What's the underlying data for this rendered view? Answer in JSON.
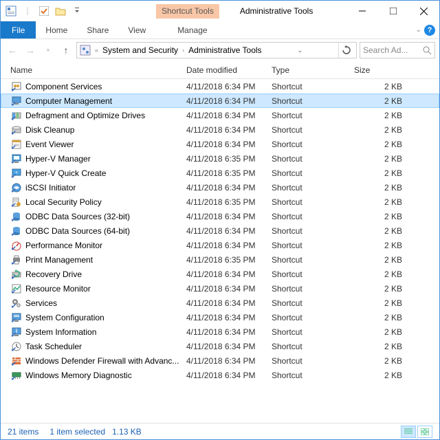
{
  "title": "Administrative Tools",
  "contextual_tab": "Shortcut Tools",
  "ribbon": {
    "file": "File",
    "home": "Home",
    "share": "Share",
    "view": "View",
    "manage": "Manage"
  },
  "breadcrumb": {
    "p1": "System and Security",
    "p2": "Administrative Tools"
  },
  "search": {
    "placeholder": "Search Ad..."
  },
  "columns": {
    "name": "Name",
    "date": "Date modified",
    "type": "Type",
    "size": "Size"
  },
  "status": {
    "count": "21 items",
    "selection": "1 item selected",
    "size": "1.13 KB"
  },
  "items": [
    {
      "name": "Component Services",
      "date": "4/11/2018 6:34 PM",
      "type": "Shortcut",
      "size": "2 KB",
      "icon": "component"
    },
    {
      "name": "Computer Management",
      "date": "4/11/2018 6:34 PM",
      "type": "Shortcut",
      "size": "2 KB",
      "icon": "computer",
      "selected": true
    },
    {
      "name": "Defragment and Optimize Drives",
      "date": "4/11/2018 6:34 PM",
      "type": "Shortcut",
      "size": "2 KB",
      "icon": "defrag"
    },
    {
      "name": "Disk Cleanup",
      "date": "4/11/2018 6:34 PM",
      "type": "Shortcut",
      "size": "2 KB",
      "icon": "disk"
    },
    {
      "name": "Event Viewer",
      "date": "4/11/2018 6:34 PM",
      "type": "Shortcut",
      "size": "2 KB",
      "icon": "event"
    },
    {
      "name": "Hyper-V Manager",
      "date": "4/11/2018 6:35 PM",
      "type": "Shortcut",
      "size": "2 KB",
      "icon": "hyperv"
    },
    {
      "name": "Hyper-V Quick Create",
      "date": "4/11/2018 6:35 PM",
      "type": "Shortcut",
      "size": "2 KB",
      "icon": "hypervq"
    },
    {
      "name": "iSCSI Initiator",
      "date": "4/11/2018 6:34 PM",
      "type": "Shortcut",
      "size": "2 KB",
      "icon": "iscsi"
    },
    {
      "name": "Local Security Policy",
      "date": "4/11/2018 6:35 PM",
      "type": "Shortcut",
      "size": "2 KB",
      "icon": "policy"
    },
    {
      "name": "ODBC Data Sources (32-bit)",
      "date": "4/11/2018 6:34 PM",
      "type": "Shortcut",
      "size": "2 KB",
      "icon": "odbc"
    },
    {
      "name": "ODBC Data Sources (64-bit)",
      "date": "4/11/2018 6:34 PM",
      "type": "Shortcut",
      "size": "2 KB",
      "icon": "odbc"
    },
    {
      "name": "Performance Monitor",
      "date": "4/11/2018 6:34 PM",
      "type": "Shortcut",
      "size": "2 KB",
      "icon": "perf"
    },
    {
      "name": "Print Management",
      "date": "4/11/2018 6:35 PM",
      "type": "Shortcut",
      "size": "2 KB",
      "icon": "print"
    },
    {
      "name": "Recovery Drive",
      "date": "4/11/2018 6:34 PM",
      "type": "Shortcut",
      "size": "2 KB",
      "icon": "recovery"
    },
    {
      "name": "Resource Monitor",
      "date": "4/11/2018 6:34 PM",
      "type": "Shortcut",
      "size": "2 KB",
      "icon": "resource"
    },
    {
      "name": "Services",
      "date": "4/11/2018 6:34 PM",
      "type": "Shortcut",
      "size": "2 KB",
      "icon": "services"
    },
    {
      "name": "System Configuration",
      "date": "4/11/2018 6:34 PM",
      "type": "Shortcut",
      "size": "2 KB",
      "icon": "sysconfig"
    },
    {
      "name": "System Information",
      "date": "4/11/2018 6:34 PM",
      "type": "Shortcut",
      "size": "2 KB",
      "icon": "sysinfo"
    },
    {
      "name": "Task Scheduler",
      "date": "4/11/2018 6:34 PM",
      "type": "Shortcut",
      "size": "2 KB",
      "icon": "task"
    },
    {
      "name": "Windows Defender Firewall with Advanc...",
      "date": "4/11/2018 6:34 PM",
      "type": "Shortcut",
      "size": "2 KB",
      "icon": "firewall"
    },
    {
      "name": "Windows Memory Diagnostic",
      "date": "4/11/2018 6:34 PM",
      "type": "Shortcut",
      "size": "2 KB",
      "icon": "memory"
    }
  ]
}
